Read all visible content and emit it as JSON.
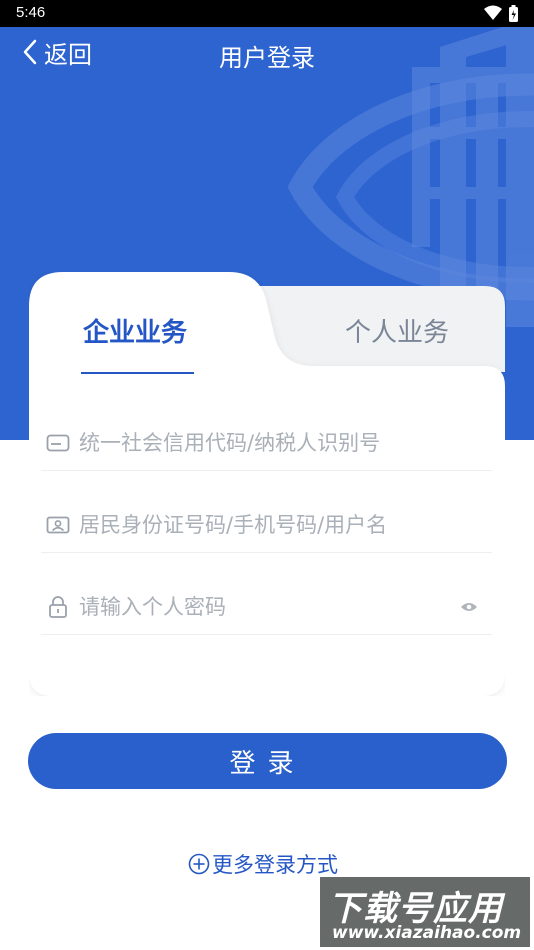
{
  "status_bar": {
    "time": "5:46"
  },
  "nav": {
    "back_label": "返回",
    "title": "用户登录"
  },
  "tabs": [
    {
      "label": "企业业务",
      "active": true
    },
    {
      "label": "个人业务",
      "active": false
    }
  ],
  "fields": {
    "credit_code": {
      "value": "",
      "placeholder": "统一社会信用代码/纳税人识别号"
    },
    "identity": {
      "value": "",
      "placeholder": "居民身份证号码/手机号码/用户名"
    },
    "password": {
      "value": "",
      "placeholder": "请输入个人密码"
    }
  },
  "login_button": {
    "label": "登录"
  },
  "more_login": {
    "label": "更多登录方式"
  },
  "watermark": {
    "main": "下载号应用",
    "url": "www.xiazaihao.com"
  },
  "colors": {
    "brand_blue": "#2e64d0",
    "accent": "#2457c5",
    "button": "#2a60cc"
  },
  "icons": [
    "chevron-left-icon",
    "id-card-icon",
    "person-card-icon",
    "lock-icon",
    "eye-icon",
    "plus-circle-icon",
    "wifi-icon",
    "battery-icon"
  ]
}
